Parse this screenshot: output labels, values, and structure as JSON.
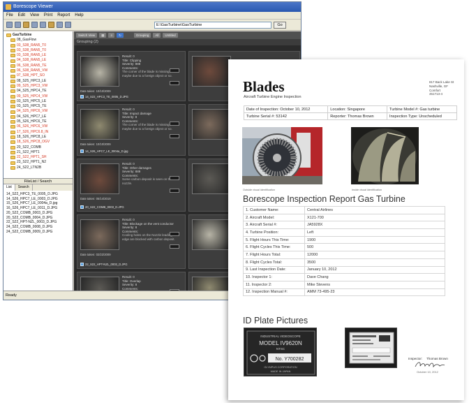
{
  "app": {
    "title": "Borescope Viewer",
    "menu": [
      "File",
      "Edit",
      "View",
      "Print",
      "Report",
      "Help"
    ],
    "path_value": "E:\\GasTurbine\\GasTurbine",
    "go_label": "Go",
    "tree_root": "GasTurbine",
    "tree_items": [
      {
        "label": "08_GasFlow",
        "color": "black"
      },
      {
        "label": "03_S38_RAN5_T0",
        "color": "red"
      },
      {
        "label": "03_S38_RAN5_T0",
        "color": "red"
      },
      {
        "label": "03_S38_RAN5_LE",
        "color": "red"
      },
      {
        "label": "04_S38_RAN5_LE",
        "color": "red"
      },
      {
        "label": "06_S38_RAN5_TE",
        "color": "red"
      },
      {
        "label": "06_S38_RAN5_VW",
        "color": "red"
      },
      {
        "label": "07_S38_HPT_SO",
        "color": "red"
      },
      {
        "label": "08_S25_HPC3_LE",
        "color": "black"
      },
      {
        "label": "09_S25_HPC3_VW",
        "color": "red"
      },
      {
        "label": "04_S25_HPC4_TE",
        "color": "black"
      },
      {
        "label": "09_S25_HPC4_VW",
        "color": "red"
      },
      {
        "label": "03_S25_HPC5_LE",
        "color": "black"
      },
      {
        "label": "03_S25_HPC5_TE",
        "color": "black"
      },
      {
        "label": "04_S25_HPC6_VW",
        "color": "red"
      },
      {
        "label": "04_S26_HPC7_LE",
        "color": "black"
      },
      {
        "label": "05_S26_HPC6_TE",
        "color": "black"
      },
      {
        "label": "06_S26_HPC6_VW",
        "color": "red"
      },
      {
        "label": "17_S26_HPC6.8_IN",
        "color": "red"
      },
      {
        "label": "18_S26_HPC8_LE",
        "color": "black"
      },
      {
        "label": "18_S26_HPC8_OGV",
        "color": "red"
      },
      {
        "label": "20_S22_COMB",
        "color": "black"
      },
      {
        "label": "21_S22_HPT1",
        "color": "black"
      },
      {
        "label": "22_S22_HPT1_SH",
        "color": "red"
      },
      {
        "label": "23_S22_HPT1_N2",
        "color": "black"
      },
      {
        "label": "24_S22_LTN2B",
        "color": "black"
      }
    ],
    "filelist_title": "FileList / Search",
    "filelist_tabs": [
      "List",
      "Search"
    ],
    "files": [
      "14_S22_HPC3_TE_0005_D.JPG",
      "14_S26_HPC7_LE_0003_D.JPG",
      "15_S26_HPC7_LE_0004a_D.jpg",
      "16_S26_HPC7_LE_0011_D.JPG",
      "20_S22_COMB_0003_D.JPG",
      "20_S22_COMB_0004_D.JPG",
      "22_S22_HPT-NZL_0003_D.JPG",
      "24_S22_COMB_0008_D.JPG",
      "24_S22_COMB_0009_D.JPG"
    ],
    "viewer_toolbar": [
      "Switch View",
      "Grouping",
      "All",
      "Untitled"
    ],
    "grouping_label": "Grouping (2)",
    "cards": [
      {
        "result": "Result: 0",
        "title": "Title: Clipping",
        "severity": "Severity: 888",
        "comments": "Comments:",
        "desc": "The corner of the blade is missing, maybe due to a foreign object or so.",
        "date": "Date taken: 10/10/2009",
        "fname": "14_S22_HPC3_TE_0005_D.JPG"
      },
      {
        "result": "Result: 0",
        "title": "Title: Impact damage",
        "severity": "Severity: 8",
        "comments": "Comments:",
        "desc": "The corner of the blade is missing, maybe due to a foreign object or so.",
        "date": "Date taken: 10/10/2009",
        "fname": "14_S26_HPC7_LE_0004a_D.jpg"
      },
      {
        "result": "Result: 0",
        "title": "Title: Other damages",
        "severity": "Severity: 889",
        "comments": "Comments:",
        "desc": "Some carbon deposit is seen on the fuel nozzle.",
        "date": "Date taken: 05/14/2019",
        "fname": "20_S22_COMB_0003_D.JPG"
      },
      {
        "result": "Result: 0",
        "title": "Title: Blockage on the vent conductor",
        "severity": "Severity: 8",
        "comments": "Comments:",
        "desc": "Cooling holes on the Nozzle leading edge are blocked with carbon deposit.",
        "date": "Date taken: 02/22/2009",
        "fname": "22_S22_HPT-NZL_0003_D.JPG"
      },
      {
        "result": "Result: 0",
        "title": "Title: Overlap",
        "severity": "Severity: 8",
        "comments": "Comments:",
        "desc": "",
        "date": "",
        "fname": ""
      }
    ],
    "status": "Ready"
  },
  "report": {
    "brand": "Blades",
    "subtitle": "Aircraft Turbine Engine Inspection",
    "address": [
      "817 Back Lake St",
      "Nashville, GF",
      "Comfort",
      "451713-4"
    ],
    "info": {
      "date": "Date of Inspection: October 10, 2012",
      "location": "Location: Singapore",
      "model": "Turbine Model #: Gas turbine",
      "serial": "Turbine Serial #: 53142",
      "reporter": "Reporter: Thomas Brown",
      "type": "Inspection Type: Unscheduled"
    },
    "caption1": "Outside visual identification",
    "caption2": "Inside visual identification",
    "heading": "Borescope Inspection Report Gas Turbine",
    "details": [
      {
        "label": "1. Customer Name:",
        "value": "Central Airlines"
      },
      {
        "label": "2. Aircraft Model:",
        "value": "X121-700"
      },
      {
        "label": "3. Aircraft Serial #:",
        "value": "JA5928X"
      },
      {
        "label": "4. Turbine Position:",
        "value": "Left"
      },
      {
        "label": "5. Flight Hours This Time:",
        "value": "1900"
      },
      {
        "label": "6. Flight Cycles This Time:",
        "value": "500"
      },
      {
        "label": "7. Flight Hours Total:",
        "value": "12000"
      },
      {
        "label": "8. Flight Cycles Total:",
        "value": "3500"
      },
      {
        "label": "9. Last Inspection Date:",
        "value": "January 10, 2012"
      },
      {
        "label": "10. Inspector 1:",
        "value": "Dave Chang"
      },
      {
        "label": "11. Inspector 2:",
        "value": "Mike Stevens"
      },
      {
        "label": "12. Inspection Manual #:",
        "value": "AMM 73-495-23"
      }
    ],
    "id_heading": "ID Plate Pictures",
    "plate1": {
      "l1": "INDUSTRIAL VIDEOSCOPE",
      "l2": "MODEL IV9620N",
      "l3": "NTSC",
      "l4": "No. Y700282",
      "l5": "OLYMPUS CORPORATION",
      "l6": "MADE IN JAPAN"
    },
    "inspector_label": "Inspector:",
    "inspector_name": "Thomas Brown",
    "inspector_date": "October 10, 2012"
  }
}
